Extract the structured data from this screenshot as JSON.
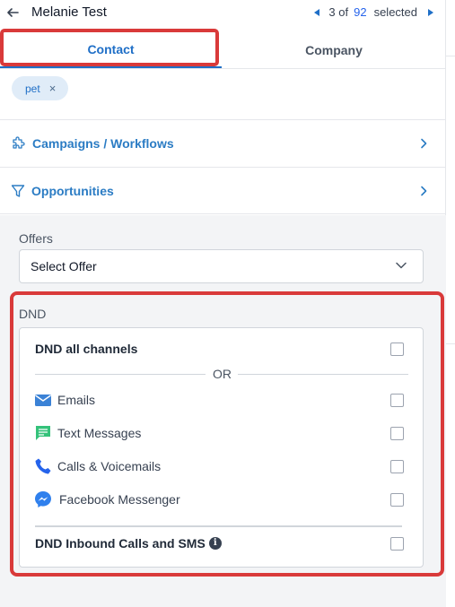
{
  "header": {
    "title": "Melanie Test",
    "pager_position": "3 of",
    "pager_total": "92",
    "pager_selected": "selected"
  },
  "tabs": [
    {
      "label": "Contact",
      "active": true
    },
    {
      "label": "Company",
      "active": false
    }
  ],
  "tags": [
    {
      "label": "pet",
      "remove_symbol": "×"
    }
  ],
  "sections": {
    "campaigns": "Campaigns / Workflows",
    "opportunities": "Opportunities"
  },
  "offers": {
    "label": "Offers",
    "select_value": "Select Offer"
  },
  "dnd": {
    "label": "DND",
    "all_channels": "DND all channels",
    "or_text": "OR",
    "channels": [
      {
        "label": "Emails",
        "icon": "envelope-icon",
        "checked": false
      },
      {
        "label": "Text Messages",
        "icon": "chat-icon",
        "checked": false
      },
      {
        "label": "Calls & Voicemails",
        "icon": "phone-icon",
        "checked": false
      },
      {
        "label": "Facebook Messenger",
        "icon": "messenger-icon",
        "checked": false
      }
    ],
    "inbound": "DND Inbound Calls and SMS",
    "info_symbol": "i"
  },
  "colors": {
    "accent": "#1f6fc7",
    "highlight": "#d93a3a",
    "email_icon": "#3b82d6",
    "sms_icon": "#34c27a",
    "phone_icon": "#2563eb",
    "messenger_icon": "#2f80ed"
  }
}
